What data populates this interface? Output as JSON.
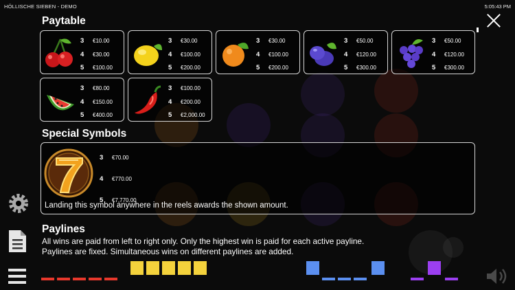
{
  "topbar": {
    "title": "HÖLLISCHE SIEBEN - DEMO",
    "time": "5:05:43 PM"
  },
  "paytable": {
    "title": "Paytable",
    "symbols": [
      {
        "icon": "cherries-icon",
        "pays": [
          {
            "count": "3",
            "amount": "€10.00"
          },
          {
            "count": "4",
            "amount": "€30.00"
          },
          {
            "count": "5",
            "amount": "€100.00"
          }
        ]
      },
      {
        "icon": "lemon-icon",
        "pays": [
          {
            "count": "3",
            "amount": "€30.00"
          },
          {
            "count": "4",
            "amount": "€100.00"
          },
          {
            "count": "5",
            "amount": "€200.00"
          }
        ]
      },
      {
        "icon": "orange-icon",
        "pays": [
          {
            "count": "3",
            "amount": "€30.00"
          },
          {
            "count": "4",
            "amount": "€100.00"
          },
          {
            "count": "5",
            "amount": "€200.00"
          }
        ]
      },
      {
        "icon": "plum-icon",
        "pays": [
          {
            "count": "3",
            "amount": "€50.00"
          },
          {
            "count": "4",
            "amount": "€120.00"
          },
          {
            "count": "5",
            "amount": "€300.00"
          }
        ]
      },
      {
        "icon": "grapes-icon",
        "pays": [
          {
            "count": "3",
            "amount": "€50.00"
          },
          {
            "count": "4",
            "amount": "€120.00"
          },
          {
            "count": "5",
            "amount": "€300.00"
          }
        ]
      },
      {
        "icon": "watermelon-icon",
        "pays": [
          {
            "count": "3",
            "amount": "€80.00"
          },
          {
            "count": "4",
            "amount": "€150.00"
          },
          {
            "count": "5",
            "amount": "€400.00"
          }
        ]
      },
      {
        "icon": "chili-pepper-icon",
        "pays": [
          {
            "count": "3",
            "amount": "€100.00"
          },
          {
            "count": "4",
            "amount": "€200.00"
          },
          {
            "count": "5",
            "amount": "€2,000.00"
          }
        ]
      }
    ]
  },
  "special": {
    "title": "Special Symbols",
    "icon": "seven-icon",
    "pays": [
      {
        "count": "3",
        "amount": "€70.00"
      },
      {
        "count": "4",
        "amount": "€770.00"
      },
      {
        "count": "5",
        "amount": "€7,770.00"
      }
    ],
    "description": "Landing this symbol anywhere in the reels awards the shown amount."
  },
  "paylines": {
    "title": "Paylines",
    "lines": [
      "All wins are paid from left to right only. Only the highest win is paid for each active payline.",
      "Paylines are fixed. Simultaneous wins on different paylines are added."
    ]
  },
  "colors": {
    "red": "#e8382c",
    "yellow": "#f4d23c",
    "blue": "#5b8ff0",
    "purple": "#9b3ff0"
  }
}
